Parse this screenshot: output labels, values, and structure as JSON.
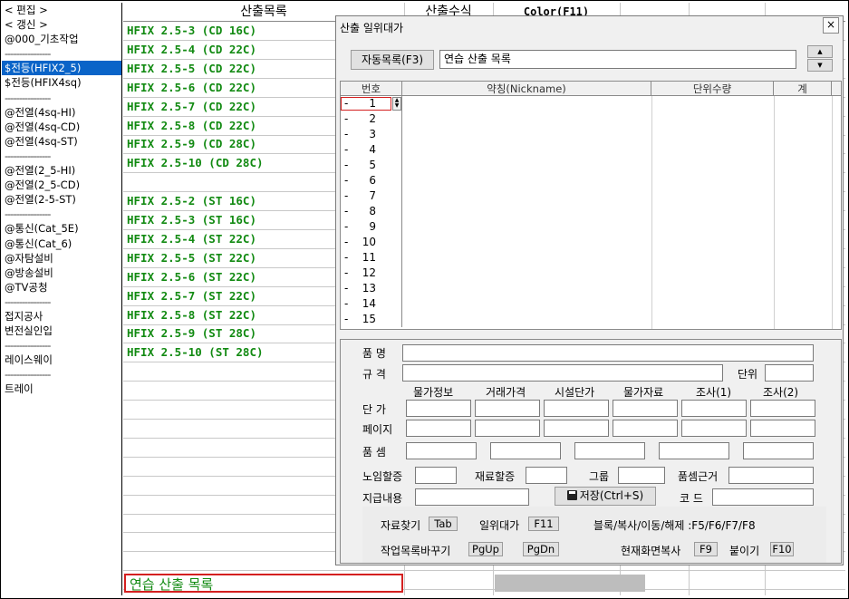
{
  "sidebar": {
    "items": [
      {
        "label": "< 편집 >"
      },
      {
        "label": "< 갱신 >"
      },
      {
        "label": "@000_기초작업"
      },
      {
        "label": "----------------",
        "sep": true
      },
      {
        "label": "$전등(HFIX2_5)",
        "selected": true
      },
      {
        "label": "$전등(HFIX4sq)"
      },
      {
        "label": "----------------",
        "sep": true
      },
      {
        "label": "@전열(4sq-HI)"
      },
      {
        "label": "@전열(4sq-CD)"
      },
      {
        "label": "@전열(4sq-ST)"
      },
      {
        "label": "----------------",
        "sep": true
      },
      {
        "label": "@전열(2_5-HI)"
      },
      {
        "label": "@전열(2_5-CD)"
      },
      {
        "label": "@전열(2-5-ST)"
      },
      {
        "label": "----------------",
        "sep": true
      },
      {
        "label": "@통신(Cat_5E)"
      },
      {
        "label": "@통신(Cat_6)"
      },
      {
        "label": "@자탐설비"
      },
      {
        "label": "@방송설비"
      },
      {
        "label": "@TV공청"
      },
      {
        "label": "----------------",
        "sep": true
      },
      {
        "label": "접지공사"
      },
      {
        "label": "변전실인입"
      },
      {
        "label": "----------------",
        "sep": true
      },
      {
        "label": "레이스웨이"
      },
      {
        "label": "----------------",
        "sep": true
      },
      {
        "label": "트레이"
      }
    ]
  },
  "main": {
    "headers": [
      "산출목록",
      "산출수식",
      "Color(F11)"
    ],
    "rows": [
      "HFIX 2.5-3 (CD 16C)",
      "HFIX 2.5-4 (CD 22C)",
      "HFIX 2.5-5 (CD 22C)",
      "HFIX 2.5-6 (CD 22C)",
      "HFIX 2.5-7 (CD 22C)",
      "HFIX 2.5-8 (CD 22C)",
      "HFIX 2.5-9 (CD 28C)",
      "HFIX 2.5-10 (CD 28C)",
      "",
      "HFIX 2.5-2 (ST 16C)",
      "HFIX 2.5-3 (ST 16C)",
      "HFIX 2.5-4 (ST 22C)",
      "HFIX 2.5-5 (ST 22C)",
      "HFIX 2.5-6 (ST 22C)",
      "HFIX 2.5-7 (ST 22C)",
      "HFIX 2.5-8 (ST 22C)",
      "HFIX 2.5-9 (ST 28C)",
      "HFIX 2.5-10 (ST 28C)"
    ],
    "bottom_input_value": "연습 산출 목록"
  },
  "dialog": {
    "title": "산출 일위대가",
    "close_label": "×",
    "auto_list_button": "자동목록(F3)",
    "list_name_value": "연습 산출 목록",
    "spin_up": "▲",
    "spin_down": "▼",
    "grid_headers": [
      "번호",
      "약칭(Nickname)",
      "단위수량",
      "계"
    ],
    "row_numbers": [
      "1",
      "2",
      "3",
      "4",
      "5",
      "6",
      "7",
      "8",
      "9",
      "10",
      "11",
      "12",
      "13",
      "14",
      "15"
    ],
    "form": {
      "name_label": "품 명",
      "spec_label": "규 격",
      "unit_label": "단위",
      "price_headers": [
        "물가정보",
        "거래가격",
        "시설단가",
        "물가자료",
        "조사(1)",
        "조사(2)"
      ],
      "price_label": "단 가",
      "page_label": "페이지",
      "pumsem_label": "품 셈",
      "labor_label": "노임할증",
      "material_label": "재료할증",
      "group_label": "그룹",
      "basis_label": "품셈근거",
      "supply_label": "지급내용",
      "save_button": "저장(Ctrl+S)",
      "code_label": "코 드"
    },
    "hints": {
      "find_label": "자료찾기",
      "find_key": "Tab",
      "unit_cost_label": "일위대가",
      "unit_cost_key": "F11",
      "block_label": "블록/복사/이동/해제 :F5/F6/F7/F8",
      "worklist_label": "작업목록바꾸기",
      "pgup_key": "PgUp",
      "pgdn_key": "PgDn",
      "screen_copy_label": "현재화면복사",
      "screen_copy_key": "F9",
      "paste_label": "붙이기",
      "paste_key": "F10"
    }
  }
}
